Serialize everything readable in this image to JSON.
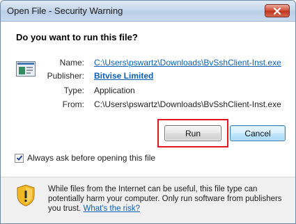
{
  "window": {
    "title": "Open File - Security Warning"
  },
  "dialog": {
    "question": "Do you want to run this file?",
    "fields": {
      "name_label": "Name:",
      "name_value": "C:\\Users\\pswartz\\Downloads\\BvSshClient-Inst.exe",
      "publisher_label": "Publisher:",
      "publisher_value": "Bitvise Limited",
      "type_label": "Type:",
      "type_value": "Application",
      "from_label": "From:",
      "from_value": "C:\\Users\\pswartz\\Downloads\\BvSshClient-Inst.exe"
    },
    "buttons": {
      "run": "Run",
      "cancel": "Cancel"
    },
    "checkbox": {
      "label": "Always ask before opening this file",
      "checked": true
    }
  },
  "footer": {
    "warning_text": "While files from the Internet can be useful, this file type can potentially harm your computer. Only run software from publishers you trust.",
    "risk_link": "What's the risk?"
  },
  "colors": {
    "link": "#0b5fb6",
    "highlight": "#e3161f",
    "close_button": "#c2351d"
  },
  "icons": {
    "close": "close-icon",
    "file": "application-file-icon",
    "shield": "security-shield-icon",
    "check": "checkmark-icon"
  }
}
